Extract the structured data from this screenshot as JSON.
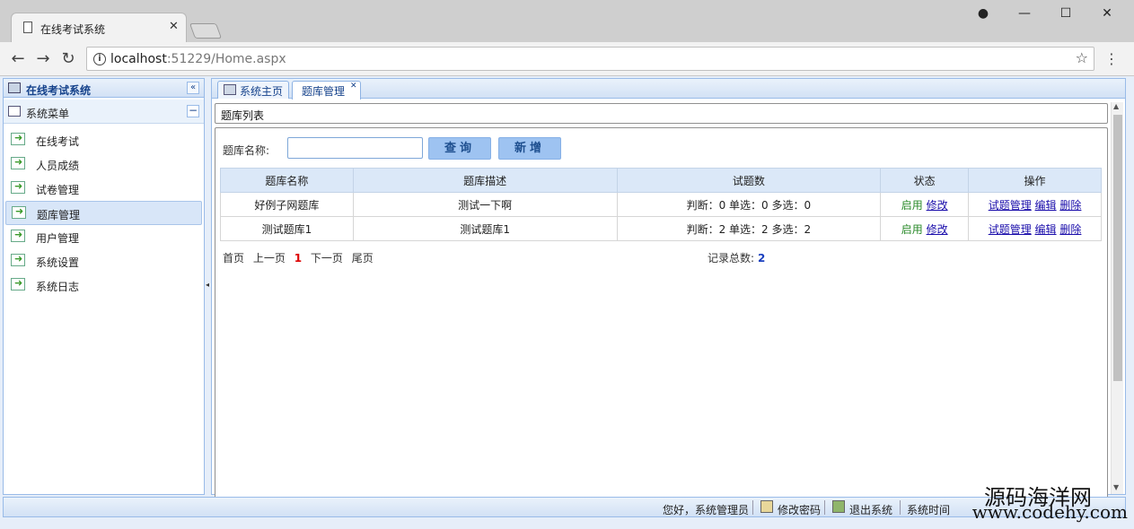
{
  "browser": {
    "tab_title": "在线考试系统",
    "url_host": "localhost",
    "url_rest": ":51229/Home.aspx"
  },
  "west": {
    "title": "在线考试系统",
    "accordion_title": "系统菜单",
    "items": [
      {
        "label": "在线考试"
      },
      {
        "label": "人员成绩"
      },
      {
        "label": "试卷管理"
      },
      {
        "label": "题库管理"
      },
      {
        "label": "用户管理"
      },
      {
        "label": "系统设置"
      },
      {
        "label": "系统日志"
      }
    ],
    "active_index": 3
  },
  "tabs": [
    {
      "label": "系统主页"
    },
    {
      "label": "题库管理"
    }
  ],
  "content": {
    "list_title": "题库列表",
    "search_label": "题库名称:",
    "search_value": "",
    "query_button": "查询",
    "add_button": "新增"
  },
  "table": {
    "headers": [
      "题库名称",
      "题库描述",
      "试题数",
      "状态",
      "操作"
    ],
    "rows": [
      {
        "name": "好例子网题库",
        "desc": "测试一下啊",
        "count": "判断：0 单选：0 多选：0",
        "status": "启用",
        "edit_status": "修改",
        "op1": "试题管理",
        "op2": "编辑",
        "op3": "删除"
      },
      {
        "name": "测试题库1",
        "desc": "测试题库1",
        "count": "判断：2 单选：2 多选：2",
        "status": "启用",
        "edit_status": "修改",
        "op1": "试题管理",
        "op2": "编辑",
        "op3": "删除"
      }
    ]
  },
  "pager": {
    "first": "首页",
    "prev": "上一页",
    "current": "1",
    "next": "下一页",
    "last": "尾页",
    "total_label": "记录总数:",
    "total": "2"
  },
  "status": {
    "greeting": "您好，系统管理员",
    "change_password": "修改密码",
    "logout": "退出系统",
    "time_label": "系统时间"
  },
  "watermark": {
    "line1": "源码海洋网",
    "line2": "www.codehy.com"
  }
}
